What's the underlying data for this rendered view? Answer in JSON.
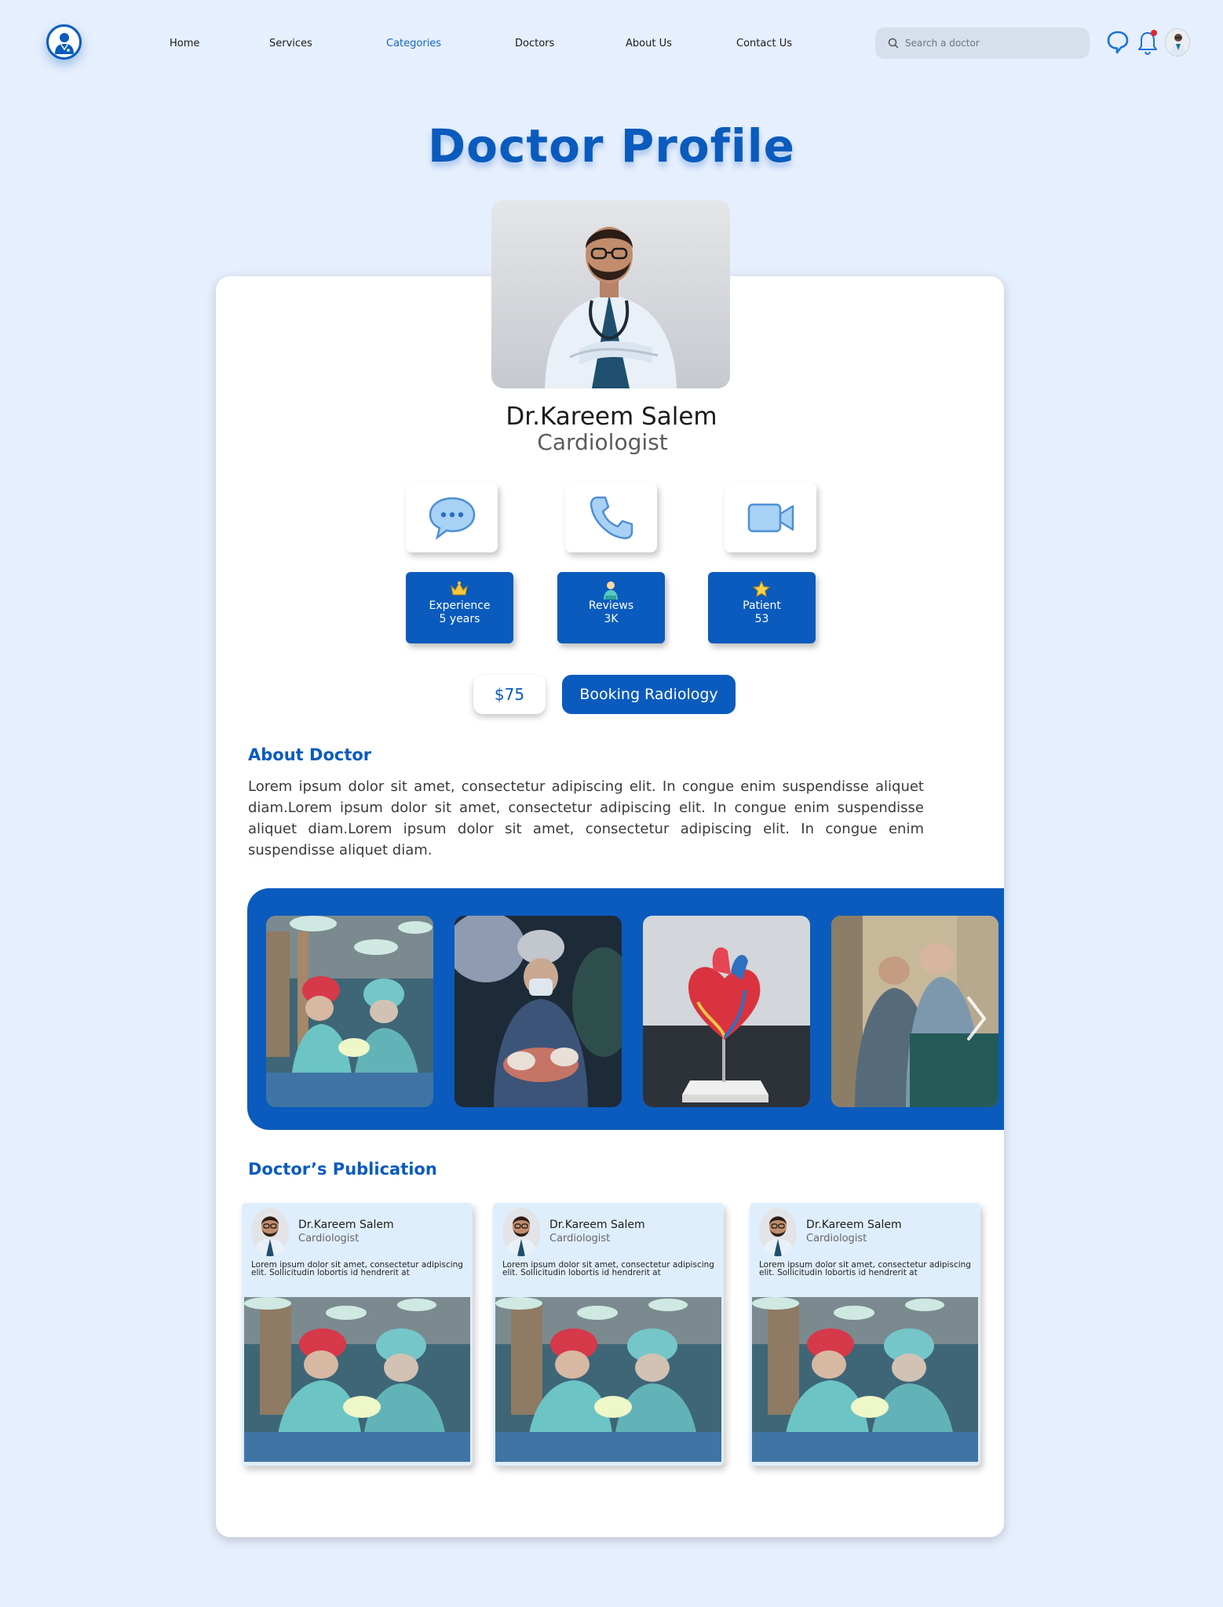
{
  "header": {
    "nav": [
      "Home",
      "Services",
      "Categories",
      "Doctors",
      "About Us",
      "Contact Us"
    ],
    "active_nav": "Categories",
    "search_placeholder": "Search a doctor"
  },
  "page_title": "Doctor Profile",
  "doctor": {
    "name": "Dr.Kareem Salem",
    "specialty": "Cardiologist"
  },
  "stats": [
    {
      "label": "Experience",
      "value": "5 years",
      "icon": "crown-icon"
    },
    {
      "label": "Reviews",
      "value": "3K",
      "icon": "person-icon"
    },
    {
      "label": "Patient",
      "value": "53",
      "icon": "star-icon"
    }
  ],
  "price": "$75",
  "booking_label": "Booking Radiology",
  "about": {
    "title": "About Doctor",
    "text": "Lorem ipsum dolor sit amet, consectetur adipiscing elit. In congue enim suspendisse aliquet diam.Lorem ipsum dolor sit amet, consectetur adipiscing elit. In congue enim suspendisse aliquet diam.Lorem ipsum dolor sit amet, consectetur adipiscing elit. In congue enim suspendisse aliquet diam."
  },
  "publications": {
    "title": "Doctor’s Publication",
    "items": [
      {
        "name": "Dr.Kareem Salem",
        "specialty": "Cardiologist",
        "text": "Lorem ipsum dolor sit amet, consectetur adipiscing elit. Sollicitudin lobortis id hendrerit at"
      },
      {
        "name": "Dr.Kareem Salem",
        "specialty": "Cardiologist",
        "text": "Lorem ipsum dolor sit amet, consectetur adipiscing elit. Sollicitudin lobortis id hendrerit at"
      },
      {
        "name": "Dr.Kareem Salem",
        "specialty": "Cardiologist",
        "text": "Lorem ipsum dolor sit amet, consectetur adipiscing elit. Sollicitudin lobortis id hendrerit at"
      }
    ]
  },
  "colors": {
    "background": "#e6effd",
    "primary": "#0a5bbd",
    "card": "#ffffff",
    "notification_dot": "#e0262e"
  }
}
